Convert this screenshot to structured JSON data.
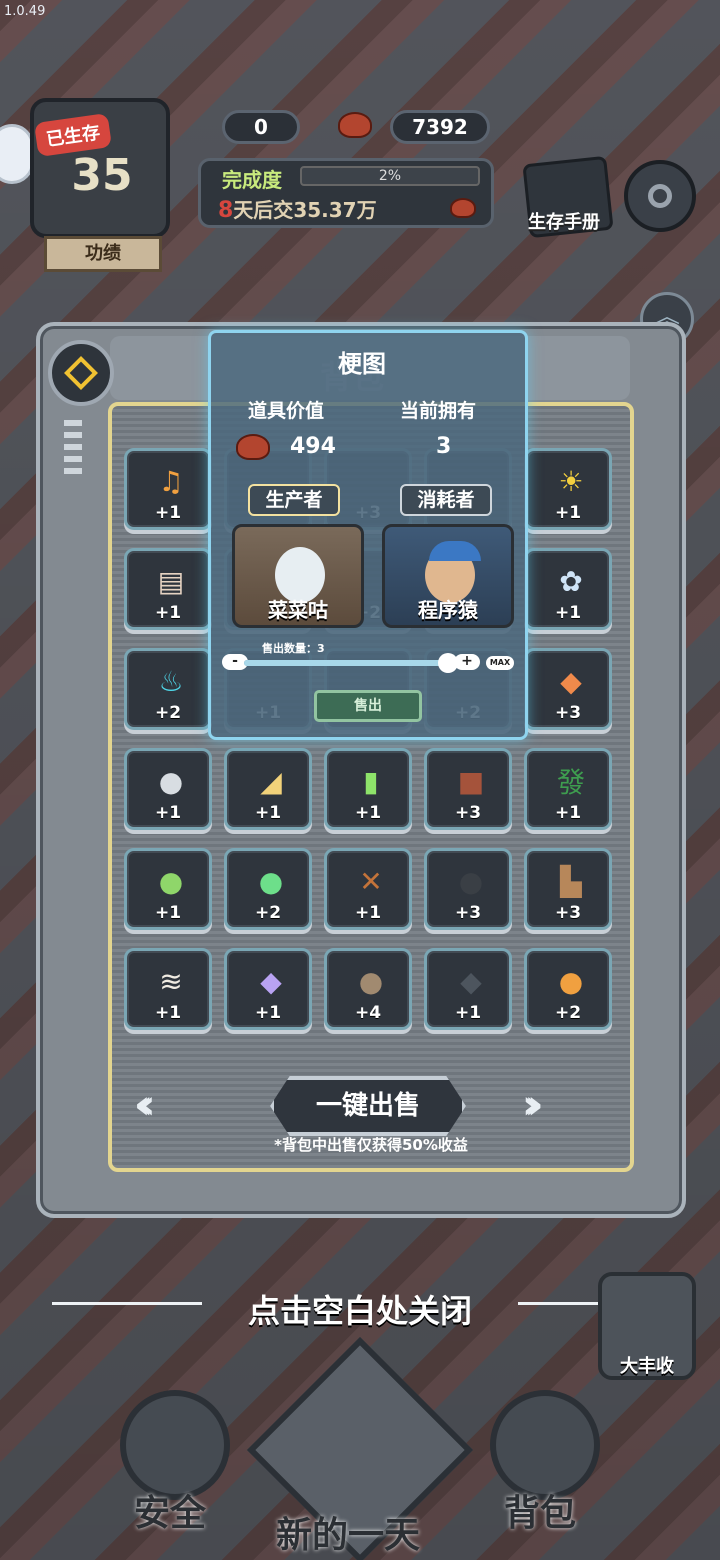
{
  "version": "1.0.49",
  "hud": {
    "survived_tag": "已生存",
    "survived_days": "35",
    "merit_label": "功绩",
    "currency_a": "0",
    "meat_amount": "7392",
    "completion_label": "完成度",
    "completion_pct": "2%",
    "completion_fraction": 0.02,
    "due_days": "8",
    "due_text": "天后交",
    "due_amount": "35.37万",
    "handbook_label": "生存手册"
  },
  "backpack": {
    "title": "背包",
    "sell_all_label": "一键出售",
    "sell_note": "*背包中出售仅获得50%收益",
    "items": [
      {
        "icon": "music-note-icon",
        "glyph": "♫",
        "color": "#f0a040",
        "count": "+1"
      },
      {
        "icon": "ghost-item-icon",
        "glyph": "",
        "color": "#888",
        "count": ""
      },
      {
        "icon": "ghost-item-icon",
        "glyph": "",
        "color": "#888",
        "count": "+3"
      },
      {
        "icon": "ghost-item-icon",
        "glyph": "",
        "color": "#888",
        "count": ""
      },
      {
        "icon": "sun-icon",
        "glyph": "☀",
        "color": "#f4d03f",
        "count": "+1"
      },
      {
        "icon": "scroll-icon",
        "glyph": "▤",
        "color": "#e6d3c2",
        "count": "+1"
      },
      {
        "icon": "ghost-item-icon",
        "glyph": "",
        "color": "#888",
        "count": ""
      },
      {
        "icon": "ghost-item-icon",
        "glyph": "",
        "color": "#888",
        "count": "+2"
      },
      {
        "icon": "ghost-item-icon",
        "glyph": "",
        "color": "#888",
        "count": ""
      },
      {
        "icon": "flower-icon",
        "glyph": "✿",
        "color": "#cfe4f7",
        "count": "+1"
      },
      {
        "icon": "blue-flame-icon",
        "glyph": "♨",
        "color": "#4fd6e8",
        "count": "+2"
      },
      {
        "icon": "ghost-item-icon",
        "glyph": "",
        "color": "#888",
        "count": "+1"
      },
      {
        "icon": "ghost-item-icon",
        "glyph": "",
        "color": "#888",
        "count": ""
      },
      {
        "icon": "ghost-item-icon",
        "glyph": "",
        "color": "#888",
        "count": "+2"
      },
      {
        "icon": "koi-fish-icon",
        "glyph": "◆",
        "color": "#f08a4b",
        "count": "+3"
      },
      {
        "icon": "seal-icon",
        "glyph": "●",
        "color": "#d8dde2",
        "count": "+1"
      },
      {
        "icon": "fish-icon",
        "glyph": "◢",
        "color": "#f2d27a",
        "count": "+1"
      },
      {
        "icon": "beer-mug-icon",
        "glyph": "▮",
        "color": "#8ee36a",
        "count": "+1"
      },
      {
        "icon": "mahjong-red-tile-icon",
        "glyph": "■",
        "color": "#a5533b",
        "count": "+3"
      },
      {
        "icon": "mahjong-fa-tile-icon",
        "glyph": "發",
        "color": "#3e9d4f",
        "count": "+1"
      },
      {
        "icon": "frog-icon",
        "glyph": "●",
        "color": "#8fd66a",
        "count": "+1"
      },
      {
        "icon": "green-drop-icon",
        "glyph": "●",
        "color": "#6ddf8a",
        "count": "+2"
      },
      {
        "icon": "skewer-icon",
        "glyph": "✕",
        "color": "#c3733a",
        "count": "+1"
      },
      {
        "icon": "trash-bag-icon",
        "glyph": "●",
        "color": "#3a3f45",
        "count": "+3"
      },
      {
        "icon": "boots-icon",
        "glyph": "▙",
        "color": "#b7875a",
        "count": "+3"
      },
      {
        "icon": "fish-bone-icon",
        "glyph": "≋",
        "color": "#f1ece3",
        "count": "+1"
      },
      {
        "icon": "crystal-icon",
        "glyph": "◆",
        "color": "#b9a3f3",
        "count": "+1"
      },
      {
        "icon": "rock-icon",
        "glyph": "●",
        "color": "#a18a70",
        "count": "+4"
      },
      {
        "icon": "ore-icon",
        "glyph": "◆",
        "color": "#4d555e",
        "count": "+1"
      },
      {
        "icon": "drumstick-icon",
        "glyph": "●",
        "color": "#f0a040",
        "count": "+2"
      }
    ]
  },
  "popup": {
    "title": "梗图",
    "value_label": "道具价值",
    "owned_label": "当前拥有",
    "price": "494",
    "owned": "3",
    "producer_label": "生产者",
    "consumer_label": "消耗者",
    "producer_name": "菜菜咕",
    "consumer_name": "程序猿",
    "qty_label": "售出数量：3",
    "qty_fraction": 1.0,
    "minus": "-",
    "plus": "+",
    "max": "MAX",
    "sell_label": "售出"
  },
  "close_hint": "点击空白处关闭",
  "harvest_label": "大丰收",
  "nav": {
    "safe": "安全",
    "new_day": "新的一天",
    "backpack": "背包"
  }
}
